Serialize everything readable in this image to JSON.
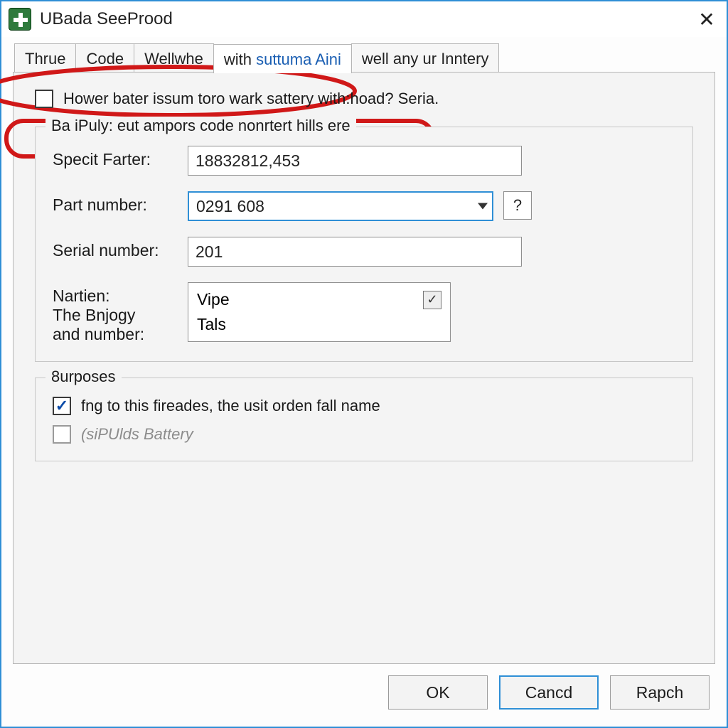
{
  "window": {
    "title": "UBada SeeProod"
  },
  "tabs": [
    {
      "label": "Thrue"
    },
    {
      "label": "Code"
    },
    {
      "label": "Wellwhe"
    },
    {
      "label_prefix": "with ",
      "label_blue": "suttuma Aini"
    },
    {
      "label": "well any ur Inntery"
    }
  ],
  "top_checkbox": {
    "label": "Hower bater issum toro wark sattery with:hoad? Seria."
  },
  "group1": {
    "legend": "Ba iPuly: eut ampors code nonrtert hills ere",
    "specit_label": "Specit Farter:",
    "specit_value": "18832812,453",
    "part_label": "Part number:",
    "part_value": "0291 608",
    "help_label": "?",
    "serial_label": "Serial number:",
    "serial_value": "201",
    "nartien_label1": "Nartien:",
    "nartien_label2": "The Bnjogy",
    "nartien_label3": "and number:",
    "list_opt1": "Vipe",
    "list_opt2": "Tals"
  },
  "group2": {
    "legend": "8urposes",
    "chk1_label": "fng to this fireades, the usit orden fall name",
    "chk2_label": "(siPUlds Battery"
  },
  "buttons": {
    "ok": "OK",
    "cancel": "Cancd",
    "rapch": "Rapch"
  }
}
